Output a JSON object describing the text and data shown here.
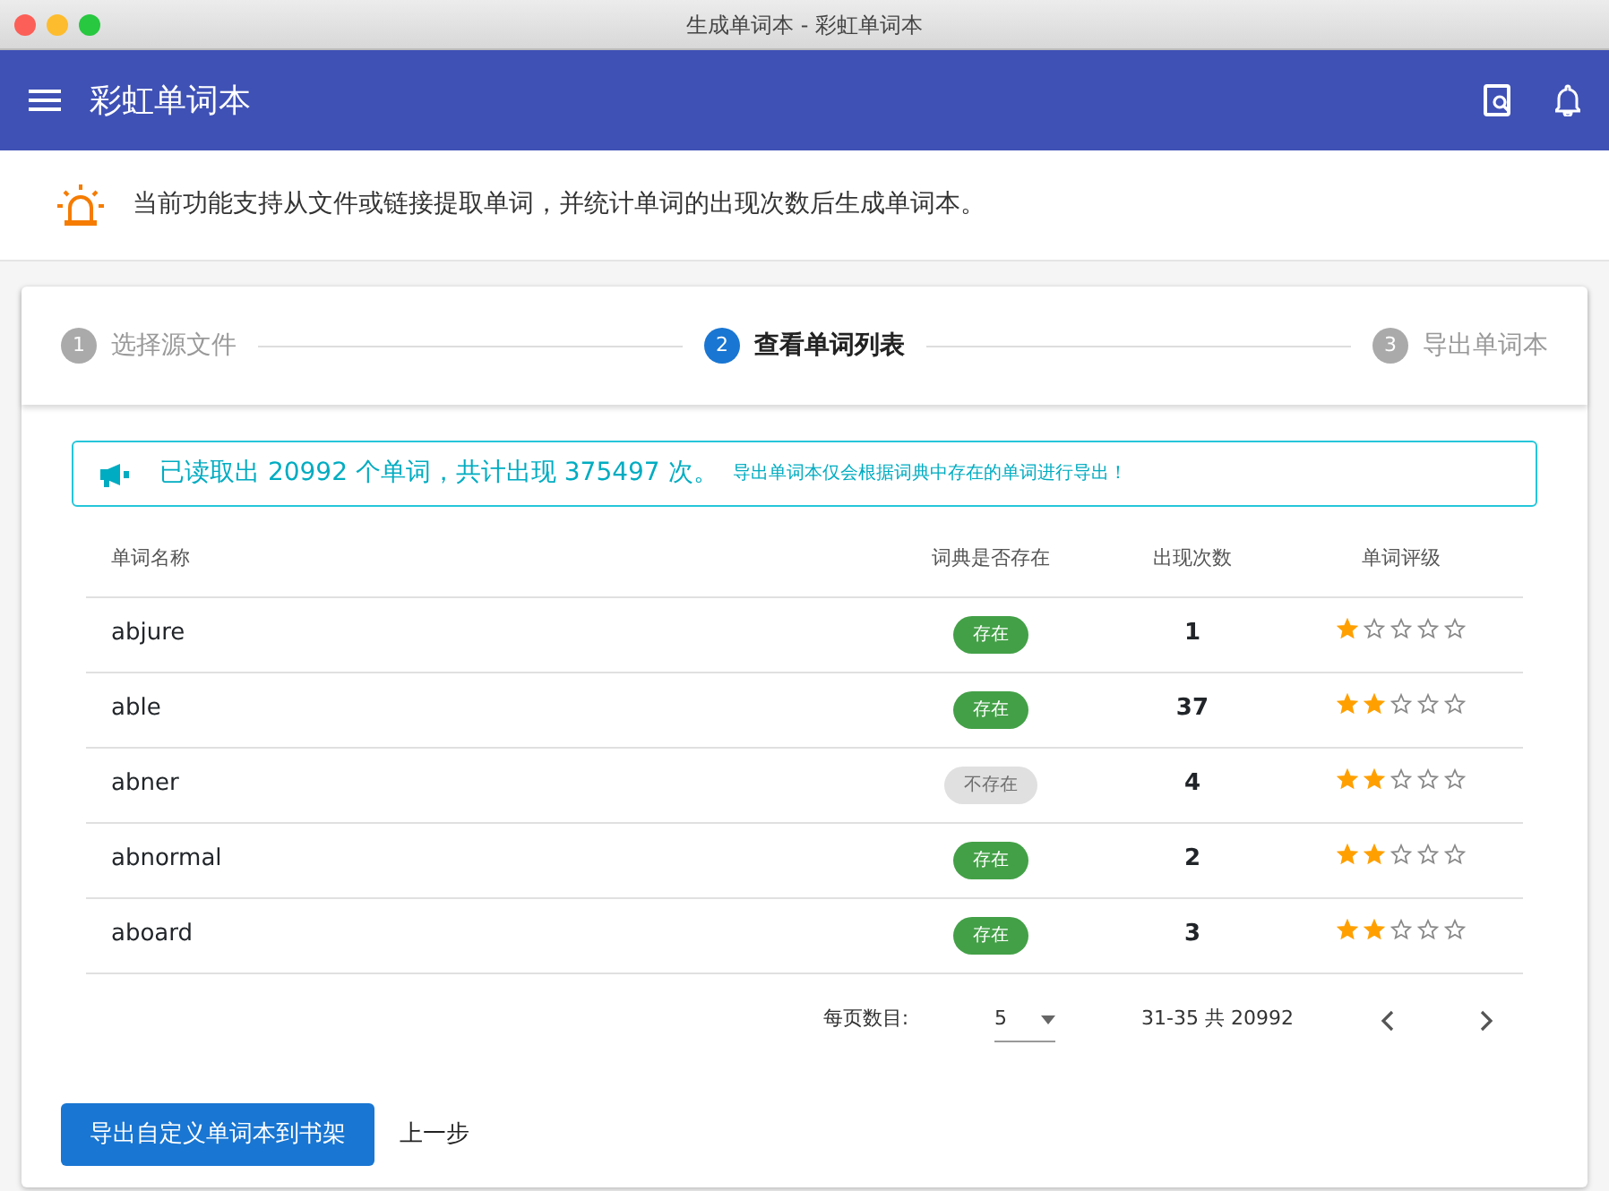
{
  "window": {
    "title": "生成单词本 - 彩虹单词本"
  },
  "app_bar": {
    "title": "彩虹单词本"
  },
  "info": {
    "text": "当前功能支持从文件或链接提取单词，并统计单词的出现次数后生成单词本。"
  },
  "steps": [
    {
      "number": "1",
      "label": "选择源文件",
      "selected": false
    },
    {
      "number": "2",
      "label": "查看单词列表",
      "selected": true
    },
    {
      "number": "3",
      "label": "导出单词本",
      "selected": false
    }
  ],
  "alert": {
    "message": "已读取出 20992 个单词，共计出现 375497 次。",
    "note": "导出单词本仅会根据词典中存在的单词进行导出！"
  },
  "table": {
    "columns": [
      "单词名称",
      "词典是否存在",
      "出现次数",
      "单词评级"
    ],
    "rows": [
      {
        "word": "abjure",
        "exists": true,
        "badge": "存在",
        "count": "1",
        "stars": 1
      },
      {
        "word": "able",
        "exists": true,
        "badge": "存在",
        "count": "37",
        "stars": 2
      },
      {
        "word": "abner",
        "exists": false,
        "badge": "不存在",
        "count": "4",
        "stars": 2
      },
      {
        "word": "abnormal",
        "exists": true,
        "badge": "存在",
        "count": "2",
        "stars": 2
      },
      {
        "word": "aboard",
        "exists": true,
        "badge": "存在",
        "count": "3",
        "stars": 2
      }
    ]
  },
  "pagination": {
    "per_page_label": "每页数目:",
    "per_page": "5",
    "range": "31-35 共 20992"
  },
  "buttons": [
    {
      "kind": "primary",
      "label": "导出自定义单词本到书架"
    },
    {
      "kind": "text",
      "label": "上一步"
    }
  ]
}
